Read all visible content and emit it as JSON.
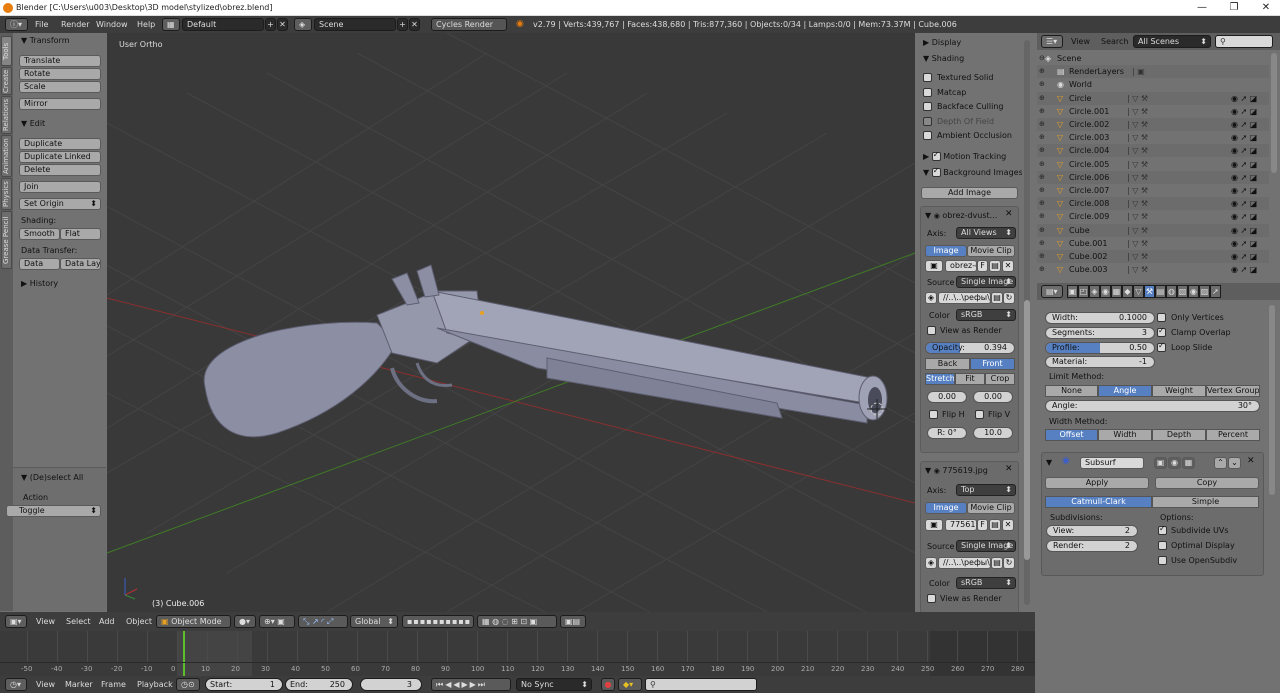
{
  "window": {
    "title": "Blender [C:\\Users\\u003\\Desktop\\3D model\\stylized\\obrez.blend]",
    "controls": [
      "—",
      "❐",
      "✕"
    ]
  },
  "menubar": {
    "items": [
      "File",
      "Render",
      "Window",
      "Help"
    ],
    "layout": "Default",
    "scene": "Scene",
    "engine": "Cycles Render",
    "stats": "v2.79 | Verts:439,767 | Faces:438,680 | Tris:877,360 | Objects:0/34 | Lamps:0/0 | Mem:73.37M | Cube.006"
  },
  "tool_tabs": [
    "Tools",
    "Create",
    "Relations",
    "Animation",
    "Physics",
    "Grease Pencil"
  ],
  "toolshelf": {
    "transform_header": "Transform",
    "transform_buttons": [
      "Translate",
      "Rotate",
      "Scale",
      "Mirror"
    ],
    "edit_header": "Edit",
    "edit_buttons": [
      "Duplicate",
      "Duplicate Linked",
      "Delete",
      "Join"
    ],
    "set_origin": "Set Origin",
    "shading_label": "Shading:",
    "smooth": "Smooth",
    "flat": "Flat",
    "data_transfer_label": "Data Transfer:",
    "data": "Data",
    "data_layout": "Data Layo",
    "history": "History",
    "operator_header": "(De)select All",
    "action_label": "Action",
    "action_value": "Toggle"
  },
  "viewport": {
    "view_label": "User Ortho",
    "object_label": "(3) Cube.006"
  },
  "npanel": {
    "display": "Display",
    "shading": "Shading",
    "shading_options": [
      {
        "label": "Textured Solid",
        "checked": false,
        "dim": false
      },
      {
        "label": "Matcap",
        "checked": false,
        "dim": false
      },
      {
        "label": "Backface Culling",
        "checked": false,
        "dim": false
      },
      {
        "label": "Depth Of Field",
        "checked": false,
        "dim": true
      },
      {
        "label": "Ambient Occlusion",
        "checked": false,
        "dim": false
      }
    ],
    "motion_tracking": "Motion Tracking",
    "background_images": "Background Images",
    "add_image": "Add Image",
    "bg1": {
      "name": "obrez-dvust...",
      "axis_label": "Axis:",
      "axis": "All Views",
      "image_tab": "Image",
      "movie_tab": "Movie Clip",
      "image_name": "obrez-d",
      "f": "F",
      "source_label": "Source",
      "source": "Single Image",
      "path": "//..\\..\\рефы\\...",
      "color_label": "Color",
      "color": "sRGB",
      "view_as_render": "View as Render",
      "opacity_label": "Opacity:",
      "opacity": "0.394",
      "back": "Back",
      "front": "Front",
      "stretch": "Stretch",
      "fit": "Fit",
      "crop": "Crop",
      "x": "0.00",
      "y": "0.00",
      "flip_h": "Flip H",
      "flip_v": "Flip V",
      "rotation": "R: 0°",
      "size": "10.0"
    },
    "bg2": {
      "name": "775619.jpg",
      "axis_label": "Axis:",
      "axis": "Top",
      "image_tab": "Image",
      "movie_tab": "Movie Clip",
      "image_name": "77561",
      "f": "F",
      "source_label": "Source",
      "source": "Single Image",
      "path": "//..\\..\\рефы\\...",
      "color_label": "Color",
      "color": "sRGB",
      "view_as_render": "View as Render"
    }
  },
  "outliner": {
    "view": "View",
    "search": "Search",
    "filter": "All Scenes",
    "items": [
      {
        "label": "Scene",
        "kind": "scene"
      },
      {
        "label": "RenderLayers",
        "kind": "layers"
      },
      {
        "label": "World",
        "kind": "world"
      },
      {
        "label": "Circle",
        "kind": "obj"
      },
      {
        "label": "Circle.001",
        "kind": "obj"
      },
      {
        "label": "Circle.002",
        "kind": "obj"
      },
      {
        "label": "Circle.003",
        "kind": "obj"
      },
      {
        "label": "Circle.004",
        "kind": "obj"
      },
      {
        "label": "Circle.005",
        "kind": "obj"
      },
      {
        "label": "Circle.006",
        "kind": "obj"
      },
      {
        "label": "Circle.007",
        "kind": "obj"
      },
      {
        "label": "Circle.008",
        "kind": "obj"
      },
      {
        "label": "Circle.009",
        "kind": "obj"
      },
      {
        "label": "Cube",
        "kind": "obj"
      },
      {
        "label": "Cube.001",
        "kind": "obj"
      },
      {
        "label": "Cube.002",
        "kind": "obj"
      },
      {
        "label": "Cube.003",
        "kind": "obj"
      }
    ]
  },
  "properties": {
    "bevel": {
      "width_label": "Width:",
      "width": "0.1000",
      "segments_label": "Segments:",
      "segments": "3",
      "profile_label": "Profile:",
      "profile": "0.50",
      "profile_fraction": 0.5,
      "material_label": "Material:",
      "material": "-1",
      "only_vertices": "Only Vertices",
      "clamp_overlap": "Clamp Overlap",
      "loop_slide": "Loop Slide",
      "limit_method_label": "Limit Method:",
      "limit_methods": [
        "None",
        "Angle",
        "Weight",
        "Vertex Group"
      ],
      "angle_label": "Angle:",
      "angle": "30°",
      "width_method_label": "Width Method:",
      "width_methods": [
        "Offset",
        "Width",
        "Depth",
        "Percent"
      ]
    },
    "subsurf": {
      "name": "Subsurf",
      "apply": "Apply",
      "copy": "Copy",
      "catmull": "Catmull-Clark",
      "simple": "Simple",
      "subdivisions_label": "Subdivisions:",
      "view_label": "View:",
      "view": "2",
      "render_label": "Render:",
      "render": "2",
      "options_label": "Options:",
      "subdivide_uvs": "Subdivide UVs",
      "optimal_display": "Optimal Display",
      "use_opensubdiv": "Use OpenSubdiv"
    }
  },
  "view3d_header": {
    "view": "View",
    "select": "Select",
    "add": "Add",
    "object": "Object",
    "mode": "Object Mode",
    "orientation": "Global"
  },
  "timeline": {
    "ticks": [
      "-50",
      "-40",
      "-30",
      "-20",
      "-10",
      "0",
      "10",
      "20",
      "30",
      "40",
      "50",
      "60",
      "70",
      "80",
      "90",
      "100",
      "110",
      "120",
      "130",
      "140",
      "150",
      "160",
      "170",
      "180",
      "190",
      "200",
      "210",
      "220",
      "230",
      "240",
      "250",
      "260",
      "270",
      "280"
    ],
    "view": "View",
    "marker": "Marker",
    "frame": "Frame",
    "playback": "Playback",
    "start_label": "Start:",
    "start": "1",
    "end_label": "End:",
    "end": "250",
    "current": "3",
    "sync": "No Sync"
  }
}
